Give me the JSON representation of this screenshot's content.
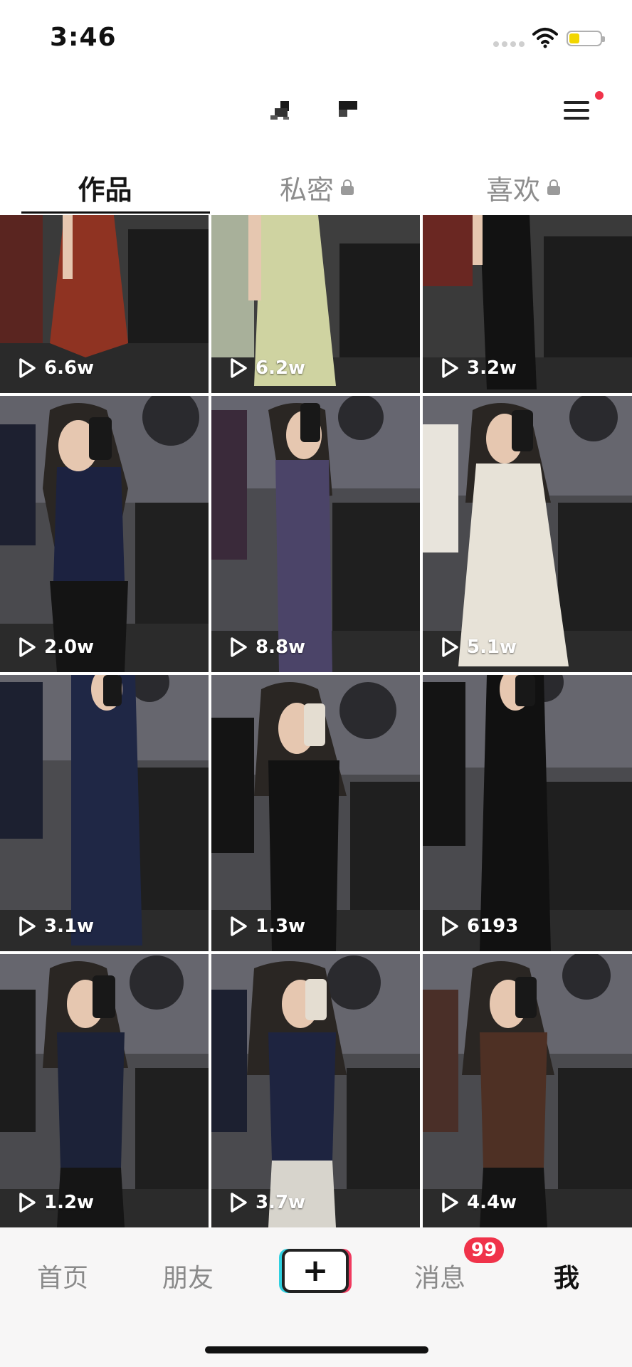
{
  "status_bar": {
    "time": "3:46"
  },
  "tabs": [
    {
      "label": "作品",
      "active": true,
      "locked": false
    },
    {
      "label": "私密",
      "active": false,
      "locked": true
    },
    {
      "label": "喜欢",
      "active": false,
      "locked": true
    }
  ],
  "videos": [
    {
      "views": "6.6w",
      "outfit": "rust-red dress"
    },
    {
      "views": "6.2w",
      "outfit": "pale green dress"
    },
    {
      "views": "3.2w",
      "outfit": "black dress"
    },
    {
      "views": "2.0w",
      "outfit": "navy knit top"
    },
    {
      "views": "8.8w",
      "outfit": "purple slit dress"
    },
    {
      "views": "5.1w",
      "outfit": "white lace dress"
    },
    {
      "views": "3.1w",
      "outfit": "navy shirt dress"
    },
    {
      "views": "1.3w",
      "outfit": "black cold-shoulder top"
    },
    {
      "views": "6193",
      "outfit": "black jumpsuit"
    },
    {
      "views": "1.2w",
      "outfit": "navy cold-shoulder top"
    },
    {
      "views": "3.7w",
      "outfit": "navy knit top with light pants"
    },
    {
      "views": "4.4w",
      "outfit": "brown v-neck top"
    }
  ],
  "bottom_nav": {
    "home": "首页",
    "friends": "朋友",
    "create": "+",
    "messages": "消息",
    "messages_badge": "99",
    "me": "我"
  },
  "colors": {
    "accent_red": "#f0334a",
    "accent_cyan": "#2fd0e0"
  }
}
